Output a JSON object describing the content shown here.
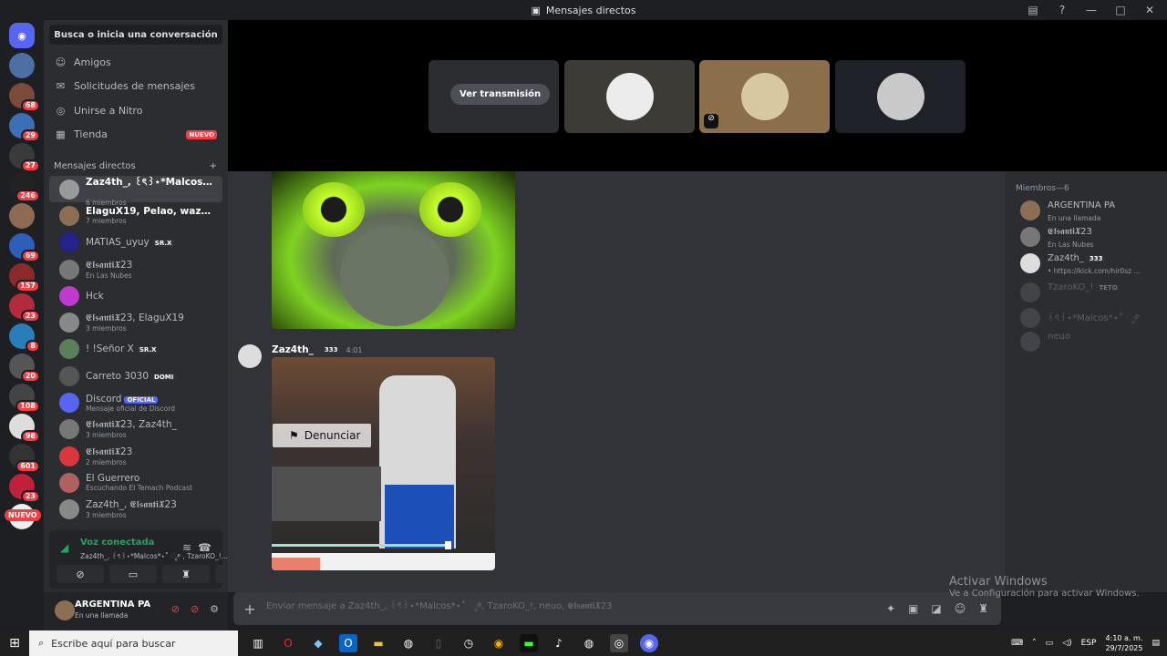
{
  "window": {
    "title": "Mensajes directos"
  },
  "server_rail": {
    "badges": [
      "68",
      "29",
      "27",
      "246",
      "69",
      "157",
      "23",
      "8",
      "20",
      "108",
      "98",
      "601",
      "23"
    ],
    "new_label": "NUEVO"
  },
  "dm_panel": {
    "search_label": "Busca o inicia una conversación",
    "nav": [
      {
        "label": "Amigos",
        "icon": "friends-icon"
      },
      {
        "label": "Solicitudes de mensajes",
        "icon": "mail-icon"
      },
      {
        "label": "Unirse a Nitro",
        "icon": "nitro-icon"
      },
      {
        "label": "Tienda",
        "icon": "shop-icon",
        "tag": "NUEVO"
      }
    ],
    "header": "Mensajes directos",
    "dms": [
      {
        "name": "Zaz4th_, ꒰ৎ꒱⋆*Malcos*⋆˚ ೃ࿔, ...",
        "sub": "6 miembros",
        "tag": ""
      },
      {
        "name": "ElaguX19, Pelao, wazex., Zaz4...",
        "sub": "7 miembros",
        "tag": ""
      },
      {
        "name": "MATIAS_uyuy",
        "sub": "",
        "tag": "SR.X"
      },
      {
        "name": "𝕰𝖑𝖘𝖆𝖓𝖙𝖎𝖃23",
        "sub": "En Las Nubes",
        "tag": ""
      },
      {
        "name": "Hck",
        "sub": "",
        "tag": ""
      },
      {
        "name": "𝕰𝖑𝖘𝖆𝖓𝖙𝖎𝖃23, ElaguX19",
        "sub": "3 miembros",
        "tag": ""
      },
      {
        "name": "! !Señor X",
        "sub": "",
        "tag": "SR.X"
      },
      {
        "name": "Carreto 3030",
        "sub": "",
        "tag": "DOMI"
      },
      {
        "name": "Discord",
        "sub": "Mensaje oficial de Discord",
        "tag": "OFICIAL"
      },
      {
        "name": "𝕰𝖑𝖘𝖆𝖓𝖙𝖎𝖃23, Zaz4th_",
        "sub": "3 miembros",
        "tag": ""
      },
      {
        "name": "𝕰𝖑𝖘𝖆𝖓𝖙𝖎𝖃23",
        "sub": "2 miembros",
        "tag": ""
      },
      {
        "name": "El Guerrero",
        "sub": "Escuchando El Temach Podcast",
        "tag": ""
      },
      {
        "name": "Zaz4th_, 𝕰𝖑𝖘𝖆𝖓𝖙𝖎𝖃23",
        "sub": "3 miembros",
        "tag": ""
      }
    ]
  },
  "voice": {
    "status": "Voz conectada",
    "channel": "Zaz4th_, ꒰ৎ꒱⋆*Malcos*⋆˚ ೃ࿔ , TzaroKO_!..."
  },
  "user": {
    "name": "ARGENTINA PA",
    "status": "En una llamada"
  },
  "stage": {
    "watch_label": "Ver transmisión"
  },
  "message": {
    "author": "Zaz4th_",
    "badge": "333",
    "time": "4:01",
    "report_label": "Denunciar"
  },
  "members": {
    "header": "Miembros—6",
    "list": [
      {
        "name": "ARGENTINA PA",
        "status": "En una llamada"
      },
      {
        "name": "𝕰𝖑𝖘𝖆𝖓𝖙𝖎𝖃23",
        "status": "En Las Nubes"
      },
      {
        "name": "Zaz4th_",
        "badge": "333",
        "status": "• https://kick.com/hir0sz ..."
      },
      {
        "name": "TzaroKO_!",
        "badge": "TETO",
        "status": ""
      },
      {
        "name": "꒰ৎ꒱⋆*Malcos*⋆˚ ೃ࿔",
        "status": ""
      },
      {
        "name": "neuo",
        "status": ""
      }
    ]
  },
  "composer": {
    "placeholder": "Enviar mensaje a Zaz4th_, ꒰ৎ꒱⋆*Malcos*⋆˚ ೃ࿔, TzaroKO_!, neuo, 𝕰𝖑𝖘𝖆𝖓𝖙𝖎𝖃23"
  },
  "watermark": {
    "title": "Activar Windows",
    "subtitle": "Ve a Configuración para activar Windows."
  },
  "taskbar": {
    "search_placeholder": "Escribe aquí para buscar",
    "lang": "ESP",
    "time": "4:10 a. m.",
    "date": "29/7/2025"
  },
  "colors": {
    "accent": "#5865f2",
    "danger": "#f23f43",
    "online": "#23a55a"
  }
}
